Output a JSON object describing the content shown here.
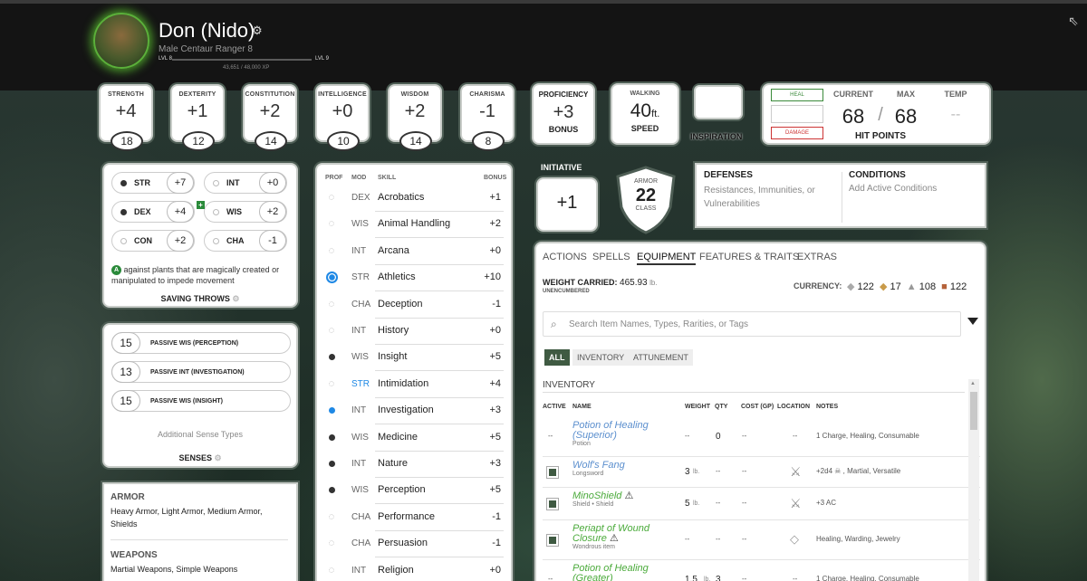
{
  "header": {
    "name": "Don (Nido)",
    "subtitle": "Male  Centaur  Ranger 8",
    "level_left": "LVL 8",
    "level_right": "LVL 9",
    "xp": "43,651 / 48,000 XP"
  },
  "abilities": [
    {
      "label": "STRENGTH",
      "mod": "+4",
      "score": "18"
    },
    {
      "label": "DEXTERITY",
      "mod": "+1",
      "score": "12"
    },
    {
      "label": "CONSTITUTION",
      "mod": "+2",
      "score": "14"
    },
    {
      "label": "INTELLIGENCE",
      "mod": "+0",
      "score": "10"
    },
    {
      "label": "WISDOM",
      "mod": "+2",
      "score": "14"
    },
    {
      "label": "CHARISMA",
      "mod": "-1",
      "score": "8"
    }
  ],
  "proficiency": {
    "title": "PROFICIENCY",
    "value": "+3",
    "bottom": "BONUS"
  },
  "speed": {
    "title": "WALKING",
    "value": "40",
    "unit": "ft.",
    "bottom": "SPEED"
  },
  "inspiration": {
    "label": "INSPIRATION"
  },
  "hp": {
    "heal": "HEAL",
    "damage": "DAMAGE",
    "current_label": "CURRENT",
    "max_label": "MAX",
    "temp_label": "TEMP",
    "current": "68",
    "slash": "/",
    "max": "68",
    "temp": "--",
    "title": "HIT POINTS"
  },
  "saving_throws": {
    "items": [
      {
        "name": "STR",
        "value": "+7",
        "proficient": true
      },
      {
        "name": "INT",
        "value": "+0",
        "proficient": false
      },
      {
        "name": "DEX",
        "value": "+4",
        "proficient": true
      },
      {
        "name": "WIS",
        "value": "+2",
        "proficient": false
      },
      {
        "name": "CON",
        "value": "+2",
        "proficient": false
      },
      {
        "name": "CHA",
        "value": "-1",
        "proficient": false
      }
    ],
    "note_icon": "A",
    "note": "against plants that are magically created or manipulated to impede movement",
    "title": "SAVING THROWS"
  },
  "senses": {
    "items": [
      {
        "value": "15",
        "label": "PASSIVE WIS (PERCEPTION)"
      },
      {
        "value": "13",
        "label": "PASSIVE INT (INVESTIGATION)"
      },
      {
        "value": "15",
        "label": "PASSIVE WIS (INSIGHT)"
      }
    ],
    "additional": "Additional Sense Types",
    "title": "SENSES"
  },
  "proficiencies": {
    "armor_title": "ARMOR",
    "armor": "Heavy Armor, Light Armor, Medium Armor, Shields",
    "weapons_title": "WEAPONS",
    "weapons": "Martial Weapons, Simple Weapons"
  },
  "skills": {
    "headers": {
      "prof": "PROF",
      "mod": "MOD",
      "skill": "SKILL",
      "bonus": "BONUS"
    },
    "items": [
      {
        "prof": "none",
        "mod": "DEX",
        "name": "Acrobatics",
        "bonus": "+1"
      },
      {
        "prof": "none",
        "mod": "WIS",
        "name": "Animal Handling",
        "bonus": "+2"
      },
      {
        "prof": "none",
        "mod": "INT",
        "name": "Arcana",
        "bonus": "+0"
      },
      {
        "prof": "expertise",
        "mod": "STR",
        "name": "Athletics",
        "bonus": "+10"
      },
      {
        "prof": "none",
        "mod": "CHA",
        "name": "Deception",
        "bonus": "-1"
      },
      {
        "prof": "none",
        "mod": "INT",
        "name": "History",
        "bonus": "+0"
      },
      {
        "prof": "full",
        "mod": "WIS",
        "name": "Insight",
        "bonus": "+5"
      },
      {
        "prof": "none",
        "mod": "STR",
        "name": "Intimidation",
        "bonus": "+4",
        "mod_blue": true
      },
      {
        "prof": "blue",
        "mod": "INT",
        "name": "Investigation",
        "bonus": "+3"
      },
      {
        "prof": "full",
        "mod": "WIS",
        "name": "Medicine",
        "bonus": "+5"
      },
      {
        "prof": "full",
        "mod": "INT",
        "name": "Nature",
        "bonus": "+3"
      },
      {
        "prof": "full",
        "mod": "WIS",
        "name": "Perception",
        "bonus": "+5"
      },
      {
        "prof": "none",
        "mod": "CHA",
        "name": "Performance",
        "bonus": "-1"
      },
      {
        "prof": "none",
        "mod": "CHA",
        "name": "Persuasion",
        "bonus": "-1"
      },
      {
        "prof": "none",
        "mod": "INT",
        "name": "Religion",
        "bonus": "+0"
      }
    ]
  },
  "initiative": {
    "label": "INITIATIVE",
    "value": "+1"
  },
  "armor_class": {
    "top": "ARMOR",
    "value": "22",
    "bottom": "CLASS"
  },
  "defenses": {
    "title": "DEFENSES",
    "text": "Resistances, Immunities, or Vulnerabilities"
  },
  "conditions": {
    "title": "CONDITIONS",
    "text": "Add Active Conditions"
  },
  "equipment": {
    "tabs": [
      "ACTIONS",
      "SPELLS",
      "EQUIPMENT",
      "FEATURES & TRAITS",
      "EXTRAS"
    ],
    "weight_label": "WEIGHT CARRIED:",
    "weight_value": "465.93",
    "weight_unit": "lb.",
    "encumbrance": "UNENCUMBERED",
    "currency_label": "CURRENCY:",
    "currency": [
      "122",
      "17",
      "108",
      "122"
    ],
    "search_placeholder": "Search Item Names, Types, Rarities, or Tags",
    "filters": [
      "ALL",
      "INVENTORY",
      "ATTUNEMENT"
    ],
    "inventory_title": "INVENTORY",
    "columns": {
      "active": "ACTIVE",
      "name": "NAME",
      "weight": "WEIGHT",
      "qty": "QTY",
      "cost": "COST (GP)",
      "location": "LOCATION",
      "notes": "NOTES"
    },
    "items": [
      {
        "active": "--",
        "name": "Potion of Healing (Superior)",
        "sub": "Potion",
        "color": "#5b8fce",
        "weight": "--",
        "qty": "0",
        "cost": "--",
        "loc": "--",
        "notes": "1 Charge, Healing, Consumable"
      },
      {
        "active": "check",
        "name": "Wolf's Fang",
        "sub": "Longsword",
        "color": "#5b8fce",
        "weight": "3",
        "qty": "--",
        "cost": "--",
        "loc": "sword",
        "notes": "+2d4 ☠ , Martial, Versatile"
      },
      {
        "active": "check",
        "name": "MinoShield",
        "sub": "Shield • Shield",
        "color": "#4aaa3a",
        "weight": "5",
        "qty": "--",
        "cost": "--",
        "loc": "sword",
        "notes": "+3 AC"
      },
      {
        "active": "check",
        "name": "Periapt of Wound Closure",
        "sub": "Wondrous item",
        "color": "#4aaa3a",
        "weight": "--",
        "qty": "--",
        "cost": "--",
        "loc": "gem",
        "notes": "Healing, Warding, Jewelry"
      },
      {
        "active": "--",
        "name": "Potion of Healing (Greater)",
        "sub": "",
        "color": "#4aaa3a",
        "weight": "1.5",
        "qty": "3",
        "cost": "--",
        "loc": "--",
        "notes": "1 Charge, Healing, Consumable"
      }
    ]
  }
}
